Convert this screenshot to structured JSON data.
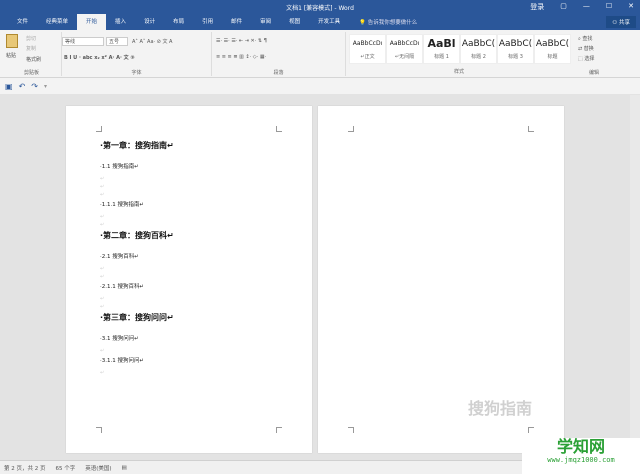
{
  "title": "文档1 [兼容模式] - Word",
  "window": {
    "login": "登录",
    "restore": "▢",
    "minimize": "—",
    "maximize": "☐",
    "close": "✕"
  },
  "tabs": [
    "文件",
    "经典菜单",
    "开始",
    "插入",
    "设计",
    "布局",
    "引用",
    "邮件",
    "审阅",
    "视图",
    "开发工具"
  ],
  "tell_me": "告诉我你想要做什么",
  "share": "共享",
  "clipboard": {
    "paste": "粘贴",
    "cut": "剪切",
    "copy": "复制",
    "format_painter": "格式刷",
    "label": "剪贴板"
  },
  "font": {
    "name": "等线",
    "size": "五号",
    "label": "字体",
    "row2": "B  I  U · abc  x₂  x²   A·  A·  文 ⑨",
    "row1b": "A˄ A˅  Aa·  ⊘  文 A"
  },
  "paragraph": {
    "label": "段落",
    "row1": "☰· ☰· ☰·  ⇤ ⇥  ✕·  ⇅  ¶",
    "row2": "≡ ≡ ≡ ≣ ▥  ↕·  ◇· ▦·"
  },
  "styles": {
    "label": "样式",
    "items": [
      {
        "preview": "AaBbCcDı",
        "name": "↵正文"
      },
      {
        "preview": "AaBbCcDı",
        "name": "↵无间隔"
      },
      {
        "preview": "AaBl",
        "name": "标题 1"
      },
      {
        "preview": "AaBbC(",
        "name": "标题 2"
      },
      {
        "preview": "AaBbC(",
        "name": "标题 3"
      },
      {
        "preview": "AaBbC(",
        "name": "标题"
      }
    ]
  },
  "editing": {
    "find": "查找",
    "replace": "替换",
    "select": "选择",
    "label": "编辑"
  },
  "page1": [
    {
      "type": "h1",
      "text": "·第一章：搜狗指南↵"
    },
    {
      "type": "h2",
      "text": "·1.1 搜狗指南↵"
    },
    {
      "type": "blank"
    },
    {
      "type": "blank"
    },
    {
      "type": "blank"
    },
    {
      "type": "h2",
      "text": "·1.1.1 搜狗指南↵"
    },
    {
      "type": "blank"
    },
    {
      "type": "blank"
    },
    {
      "type": "h1",
      "text": "·第二章：搜狗百科↵"
    },
    {
      "type": "h2",
      "text": "·2.1 搜狗百科↵"
    },
    {
      "type": "blank"
    },
    {
      "type": "blank"
    },
    {
      "type": "h2",
      "text": "·2.1.1 搜狗百科↵"
    },
    {
      "type": "blank"
    },
    {
      "type": "blank"
    },
    {
      "type": "h1",
      "text": "·第三章：搜狗问问↵"
    },
    {
      "type": "h2",
      "text": "·3.1 搜狗问问↵"
    },
    {
      "type": "blank"
    },
    {
      "type": "h2",
      "text": "·3.1.1 搜狗问问↵"
    },
    {
      "type": "blank"
    }
  ],
  "status": {
    "page": "第 2 页，共 2 页",
    "words": "65 个字",
    "lang": "英语(美国)"
  },
  "watermark": "搜狗指南",
  "site_logo": {
    "name": "学知网",
    "url": "www.jmqz1000.com"
  }
}
